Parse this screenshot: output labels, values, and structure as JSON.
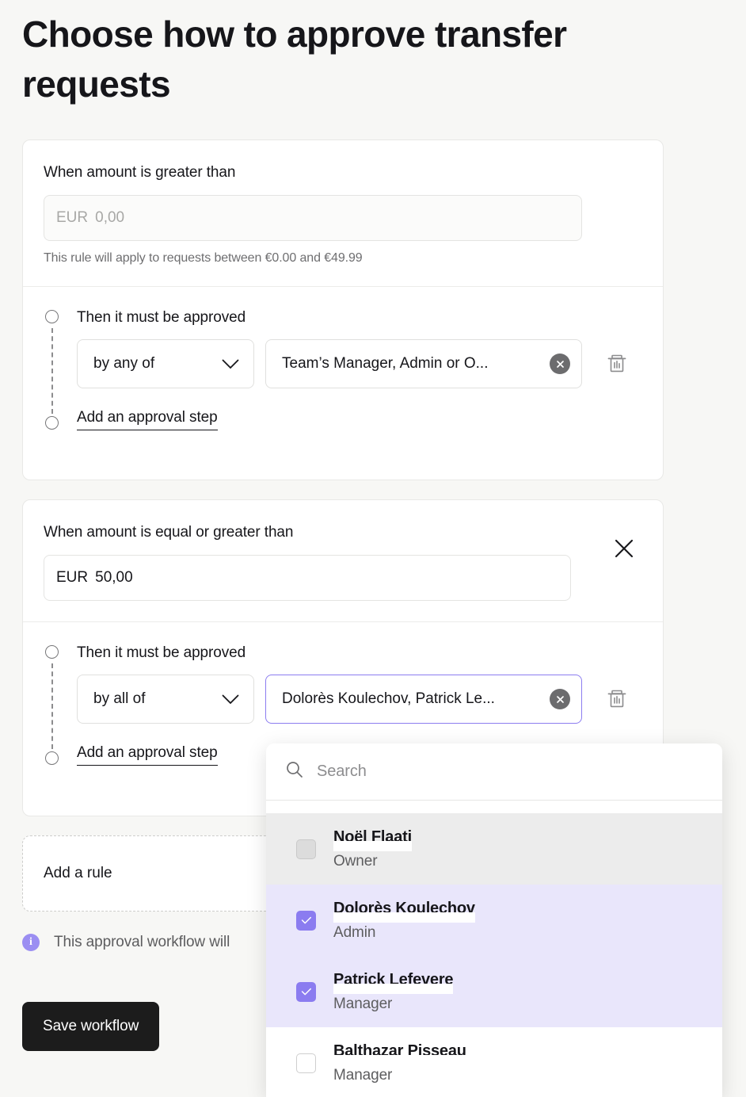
{
  "page": {
    "title": "Choose how to approve transfer requests"
  },
  "rules": [
    {
      "condition_label": "When amount is greater than",
      "amount": {
        "currency": "EUR",
        "value": "0,00",
        "state": "disabled"
      },
      "hint": "This rule will apply to requests between €0.00 and €49.99",
      "step": {
        "title": "Then it must be approved",
        "mode": "by any of",
        "mode_icon": "chevron-down-icon",
        "people": "Team’s Manager, Admin or O...",
        "clear_icon": "clear-circle-icon",
        "delete_icon": "trash-icon",
        "add_step_label": "Add an approval step"
      },
      "has_close": false
    },
    {
      "condition_label": "When amount is equal or greater than",
      "amount": {
        "currency": "EUR",
        "value": "50,00",
        "state": "active"
      },
      "hint": "",
      "step": {
        "title": "Then it must be approved",
        "mode": "by all of",
        "mode_icon": "chevron-down-icon",
        "people": "Dolorès Koulechov, Patrick Le...",
        "clear_icon": "clear-circle-icon",
        "delete_icon": "trash-icon",
        "add_step_label": "Add an approval step"
      },
      "has_close": true,
      "close_icon": "close-icon"
    }
  ],
  "add_rule": {
    "label": "Add a rule"
  },
  "info": {
    "icon": "info-icon",
    "icon_glyph": "i",
    "text": "This approval workflow will"
  },
  "save": {
    "label": "Save workflow"
  },
  "dropdown": {
    "search": {
      "icon": "search-icon",
      "placeholder": "Search",
      "value": ""
    },
    "options": [
      {
        "name": "Noël Flaati",
        "role": "Owner",
        "selected": false,
        "hover": true
      },
      {
        "name": "Dolorès Koulechov",
        "role": "Admin",
        "selected": true,
        "hover": false
      },
      {
        "name": "Patrick Lefevere",
        "role": "Manager",
        "selected": true,
        "hover": false
      },
      {
        "name": "Balthazar Pisseau",
        "role": "Manager",
        "selected": false,
        "hover": false
      }
    ]
  },
  "colors": {
    "accent": "#8b7cf0",
    "selected_row": "#e9e6fb",
    "save_button": "#1c1c1c",
    "page_background": "#f7f7f5"
  }
}
